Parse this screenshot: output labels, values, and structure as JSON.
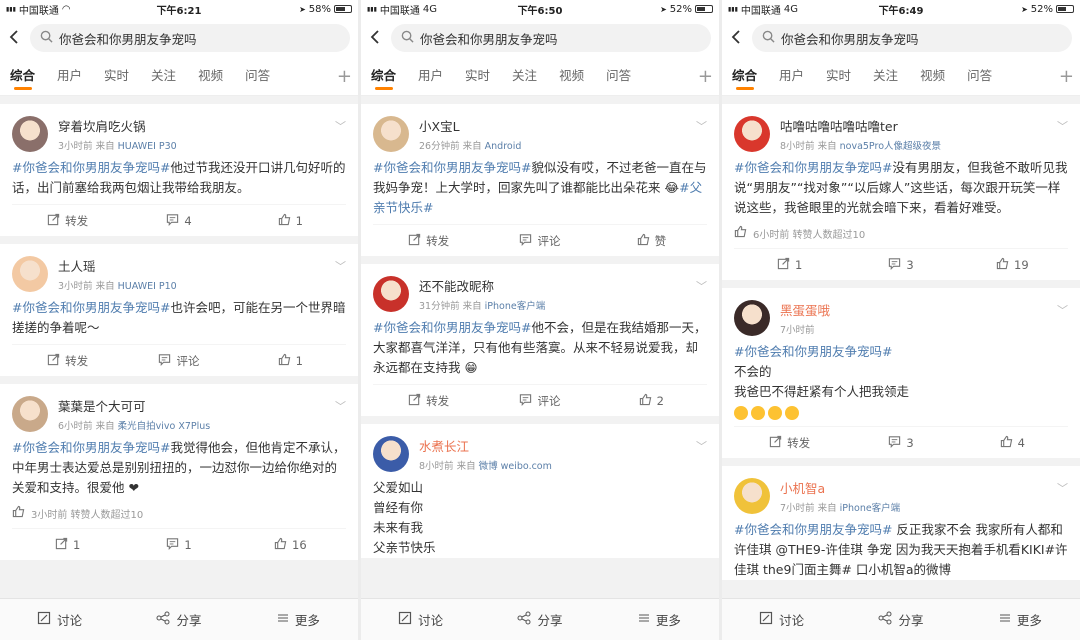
{
  "screens": [
    {
      "status": {
        "carrier": "中国联通",
        "network": "",
        "time": "下午6:21",
        "battery": "58%"
      },
      "search_query": "你爸会和你男朋友争宠吗",
      "tabs": [
        "综合",
        "用户",
        "实时",
        "关注",
        "视频",
        "问答"
      ],
      "active_tab": "综合",
      "posts": [
        {
          "name": "穿着坎肩吃火锅",
          "time": "3小时前",
          "source_prefix": "来自",
          "source": "HUAWEI P30",
          "tag": "#你爸会和你男朋友争宠吗#",
          "text": "他过节我还没开口讲几句好听的话，出门前塞给我两包烟让我带给我朋友。",
          "actions": {
            "share": "转发",
            "comment": "4",
            "like": "1"
          },
          "avatar_color": "#8a6f6a"
        },
        {
          "name": "土人瑶",
          "time": "3小时前",
          "source_prefix": "来自",
          "source": "HUAWEI P10",
          "tag": "#你爸会和你男朋友争宠吗#",
          "text": "也许会吧，可能在另一个世界暗搓搓的争着呢～",
          "actions": {
            "share": "转发",
            "comment": "评论",
            "like": "1"
          },
          "avatar_color": "#f3c9a3"
        },
        {
          "name": "葉葉是个大可可",
          "time": "6小时前",
          "source_prefix": "来自",
          "source": "柔光自拍vivo X7Plus",
          "tag": "#你爸会和你男朋友争宠吗#",
          "text": "我觉得他会，但他肯定不承认，中年男士表达爱总是别别扭扭的，一边怼你一边给你绝对的关爱和支持。很爱他 ❤",
          "forward_note": "3小时前 转赞人数超过10",
          "actions": {
            "share": "1",
            "comment": "1",
            "like": "16"
          },
          "avatar_color": "#c9a98a"
        }
      ],
      "bottom": {
        "discuss": "讨论",
        "share": "分享",
        "more": "更多"
      }
    },
    {
      "status": {
        "carrier": "中国联通",
        "network": "4G",
        "time": "下午6:50",
        "battery": "52%"
      },
      "search_query": "你爸会和你男朋友争宠吗",
      "tabs": [
        "综合",
        "用户",
        "实时",
        "关注",
        "视频",
        "问答"
      ],
      "active_tab": "综合",
      "posts": [
        {
          "name": "小X宝L",
          "time": "26分钟前",
          "source_prefix": "来自",
          "source": "Android",
          "tag": "#你爸会和你男朋友争宠吗#",
          "text": "貌似没有哎，不过老爸一直在与我妈争宠！上大学时，回家先叫了谁都能比出朵花来 😂",
          "tag2": "#父亲节快乐#",
          "actions": {
            "share": "转发",
            "comment": "评论",
            "like": "赞"
          },
          "avatar_color": "#d8b88f"
        },
        {
          "name": "还不能改昵称",
          "time": "31分钟前",
          "source_prefix": "来自",
          "source": "iPhone客户端",
          "tag": "#你爸会和你男朋友争宠吗#",
          "text": "他不会，但是在我结婚那一天，大家都喜气洋洋，只有他有些落寞。从来不轻易说爱我，却永远都在支持我 😁",
          "actions": {
            "share": "转发",
            "comment": "评论",
            "like": "2"
          },
          "avatar_color": "#c8312a"
        },
        {
          "name": "水煮长江",
          "time": "8小时前",
          "source_prefix": "来自",
          "source": "微博 weibo.com",
          "lines": [
            "父爱如山",
            "曾经有你",
            "未来有我",
            "父亲节快乐"
          ],
          "actions": {
            "share": "",
            "comment": "",
            "like": ""
          },
          "avatar_color": "#3b5ca8"
        }
      ],
      "bottom": {
        "discuss": "讨论",
        "share": "分享",
        "more": "更多"
      }
    },
    {
      "status": {
        "carrier": "中国联通",
        "network": "4G",
        "time": "下午6:49",
        "battery": "52%"
      },
      "search_query": "你爸会和你男朋友争宠吗",
      "tabs": [
        "综合",
        "用户",
        "实时",
        "关注",
        "视频",
        "问答"
      ],
      "active_tab": "综合",
      "posts": [
        {
          "name": "咕噜咕噜咕噜咕噜ter",
          "time": "8小时前",
          "source_prefix": "来自",
          "source": "nova5Pro人像超级夜景",
          "tag": "#你爸会和你男朋友争宠吗#",
          "text": "没有男朋友，但我爸不敢听见我说“男朋友”“找对象”“以后嫁人”这些话，每次跟开玩笑一样说这些，我爸眼里的光就会暗下来，看着好难受。",
          "forward_note": "6小时前 转赞人数超过10",
          "actions": {
            "share": "1",
            "comment": "3",
            "like": "19"
          },
          "avatar_color": "#d9372c"
        },
        {
          "name": "黑蛋蛋哦",
          "time": "7小时前",
          "source_prefix": "",
          "source": "",
          "tag": "#你爸会和你男朋友争宠吗#",
          "lines": [
            "不会的",
            "我爸巴不得赶紧有个人把我领走"
          ],
          "stickers": 4,
          "actions": {
            "share": "转发",
            "comment": "3",
            "like": "4"
          },
          "avatar_color": "#3a2a28"
        },
        {
          "name": "小机智a",
          "time": "7小时前",
          "source_prefix": "来自",
          "source": "iPhone客户端",
          "tag": "#你爸会和你男朋友争宠吗#",
          "text": " 反正我家不会  我家所有人都和许佳琪 @THE9-许佳琪 争宠  因为我天天抱着手机看KIKI#许佳琪 the9门面主舞# 口小机智a的微博",
          "actions": {
            "share": "",
            "comment": "",
            "like": ""
          },
          "avatar_color": "#f0c23a"
        }
      ],
      "bottom": {
        "discuss": "讨论",
        "share": "分享",
        "more": "更多"
      }
    }
  ],
  "colors": {
    "accent": "#ff8200",
    "tag": "#507daf",
    "meta": "#999999"
  },
  "icons": [
    "back-arrow-icon",
    "search-icon",
    "plus-icon",
    "chevron-down-icon",
    "share-icon",
    "comment-icon",
    "like-icon",
    "discuss-icon",
    "more-icon"
  ]
}
